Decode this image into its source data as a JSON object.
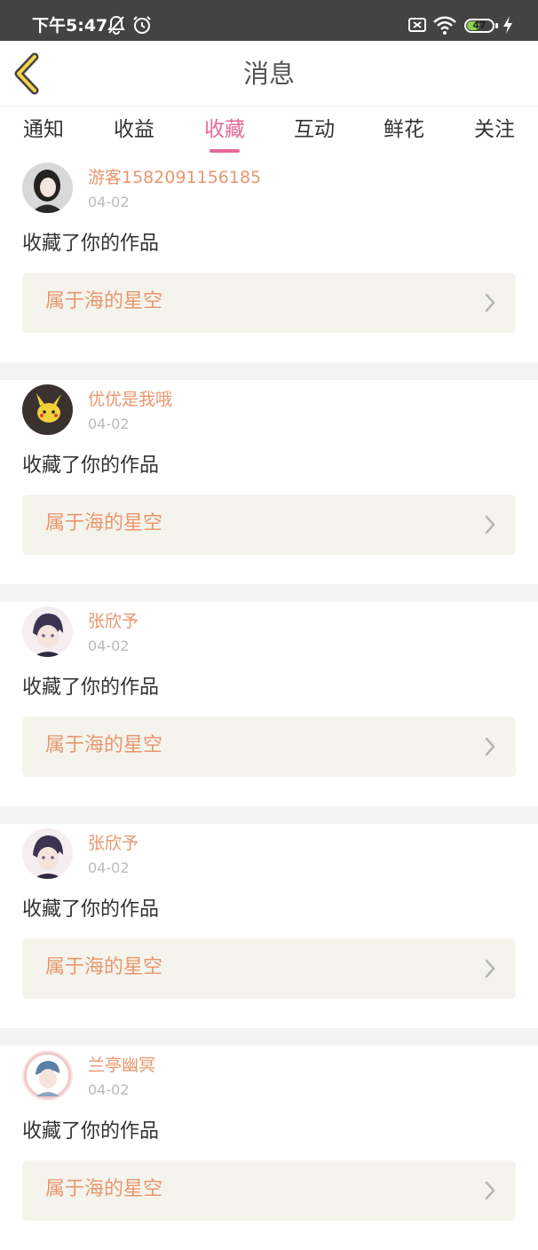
{
  "status_bar": {
    "time": "下午5:47",
    "battery_level": 47,
    "battery_label": "47",
    "icons": [
      "mute-bell-icon",
      "alarm-icon",
      "sim-error-icon",
      "wifi-icon",
      "battery-icon",
      "charging-icon"
    ]
  },
  "header": {
    "title": "消息",
    "back_icon": "chevron-left-icon"
  },
  "tabs": [
    {
      "label": "通知",
      "active": false
    },
    {
      "label": "收益",
      "active": false
    },
    {
      "label": "收藏",
      "active": true
    },
    {
      "label": "互动",
      "active": false
    },
    {
      "label": "鲜花",
      "active": false
    },
    {
      "label": "关注",
      "active": false
    }
  ],
  "colors": {
    "accent": "#e5699a",
    "username": "#e8966e",
    "work_title": "#e8966e",
    "card_bg": "#f5f4ec",
    "status_bar": "#434343"
  },
  "feed": [
    {
      "username": "游客1582091156185",
      "date": "04-02",
      "action": "收藏了你的作品",
      "work_title": "属于海的星空"
    },
    {
      "username": "优优是我哦",
      "date": "04-02",
      "action": "收藏了你的作品",
      "work_title": "属于海的星空"
    },
    {
      "username": "张欣予",
      "date": "04-02",
      "action": "收藏了你的作品",
      "work_title": "属于海的星空"
    },
    {
      "username": "张欣予",
      "date": "04-02",
      "action": "收藏了你的作品",
      "work_title": "属于海的星空"
    },
    {
      "username": "兰亭幽冥",
      "date": "04-02",
      "action": "收藏了你的作品",
      "work_title": "属于海的星空"
    }
  ]
}
